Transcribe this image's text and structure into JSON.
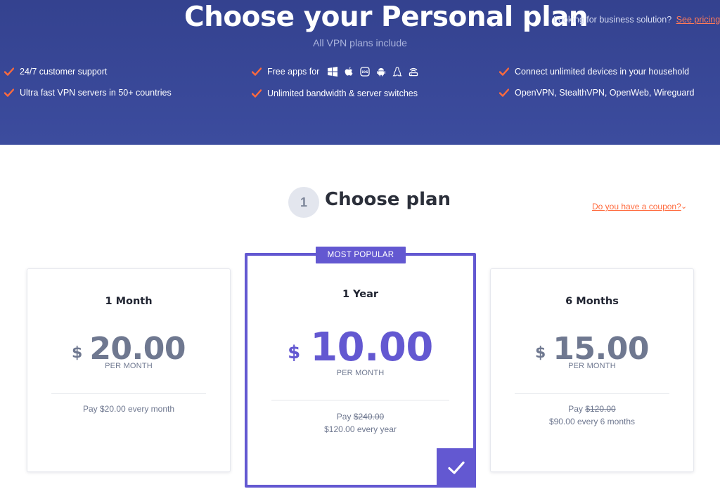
{
  "hero": {
    "title": "Choose your Personal plan",
    "subtitle": "All VPN plans include",
    "business_text": "Looking for business solution?",
    "business_link": "See pricing",
    "features": {
      "col1": [
        "24/7 customer support",
        "Ultra fast VPN servers in 50+ countries"
      ],
      "col2": [
        "Free apps for",
        "Unlimited bandwidth & server switches"
      ],
      "col3": [
        "Connect unlimited devices in your household",
        "OpenVPN, StealthVPN, OpenWeb, Wireguard"
      ]
    },
    "app_icons": [
      "windows-icon",
      "apple-icon",
      "ios-icon",
      "android-icon",
      "linux-icon",
      "router-icon"
    ],
    "accent": "#ff6a3d",
    "background": "#3a4898"
  },
  "section": {
    "step_number": "1",
    "title": "Choose plan",
    "coupon_link": "Do you have a coupon?"
  },
  "plans": {
    "month": {
      "name": "1 Month",
      "currency": "$",
      "price": "20.00",
      "per": "PER MONTH",
      "pay_line1": "Pay $20.00 every month"
    },
    "year": {
      "badge": "MOST POPULAR",
      "name": "1 Year",
      "currency": "$",
      "price": "10.00",
      "per": "PER MONTH",
      "pay_prefix": "Pay ",
      "pay_old": "$240.00",
      "pay_line2": "$120.00 every year",
      "selected": true
    },
    "six": {
      "name": "6 Months",
      "currency": "$",
      "price": "15.00",
      "per": "PER MONTH",
      "pay_prefix": "Pay ",
      "pay_old": "$120.00",
      "pay_line2": "$90.00 every 6 months"
    }
  },
  "colors": {
    "primary": "#6358d1",
    "price_gray": "#6f7890",
    "link_orange": "#ff6a3d"
  }
}
